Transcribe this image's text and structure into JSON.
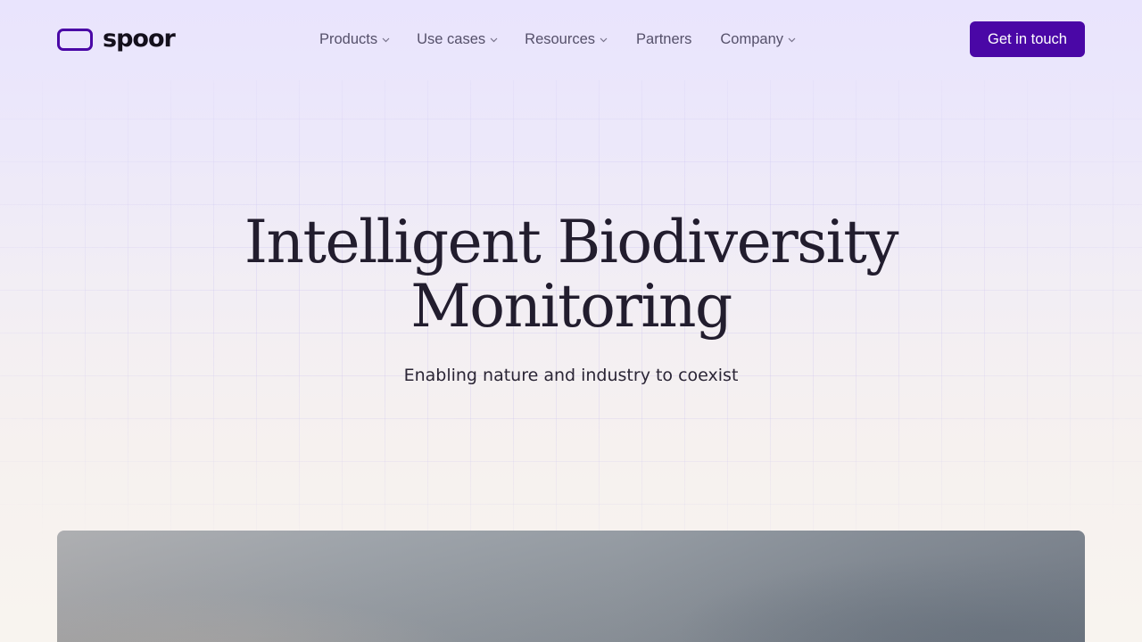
{
  "brand": {
    "name": "spoor",
    "accent_color": "#4a07a6"
  },
  "nav": {
    "items": [
      {
        "label": "Products",
        "has_dropdown": true
      },
      {
        "label": "Use cases",
        "has_dropdown": true
      },
      {
        "label": "Resources",
        "has_dropdown": true
      },
      {
        "label": "Partners",
        "has_dropdown": false
      },
      {
        "label": "Company",
        "has_dropdown": true
      }
    ]
  },
  "header": {
    "cta_label": "Get in touch"
  },
  "hero": {
    "title_line1": "Intelligent Biodiversity",
    "title_line2": "Monitoring",
    "subtitle": "Enabling nature and industry to coexist"
  },
  "icons": {
    "dropdown": "chevron-down-icon",
    "logo": "rounded-rectangle-logo-icon"
  }
}
